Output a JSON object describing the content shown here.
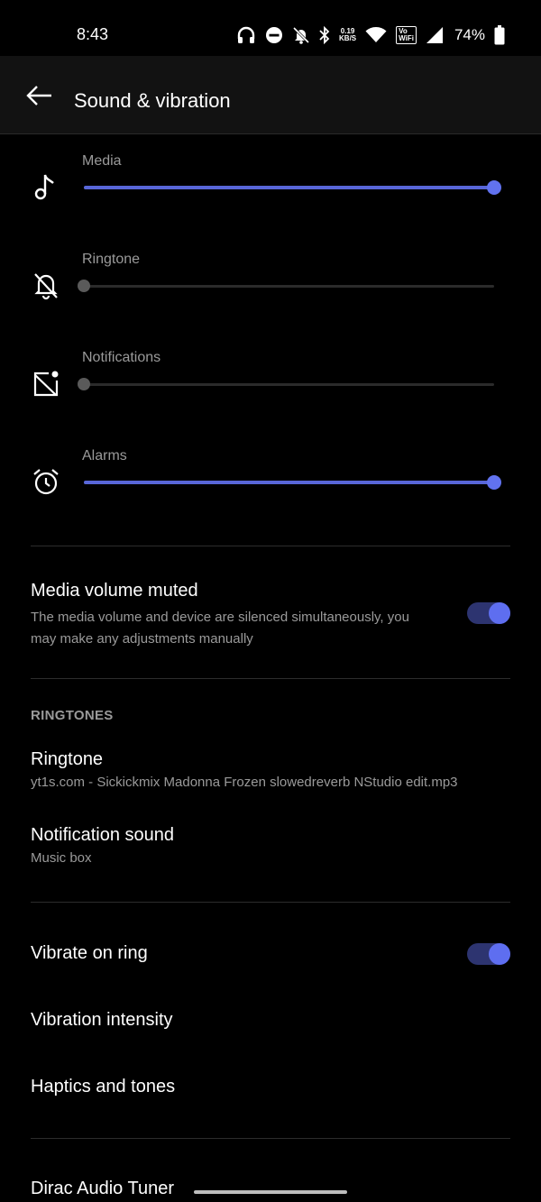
{
  "status_bar": {
    "time": "8:43",
    "net_speed_value": "0.19",
    "net_speed_unit": "KB/S",
    "volte_top": "Vo",
    "volte_bottom": "WiFi",
    "battery": "74%"
  },
  "header": {
    "title": "Sound & vibration"
  },
  "volumes": [
    {
      "label": "Media",
      "icon": "music-note-icon",
      "level": 1.0,
      "active": true
    },
    {
      "label": "Ringtone",
      "icon": "bell-off-icon",
      "level": 0.0,
      "active": false
    },
    {
      "label": "Notifications",
      "icon": "notification-off-icon",
      "level": 0.0,
      "active": false
    },
    {
      "label": "Alarms",
      "icon": "alarm-icon",
      "level": 1.0,
      "active": true
    }
  ],
  "media_muted": {
    "title": "Media volume muted",
    "subtitle_line1": "The media volume and device are silenced simultaneously, you",
    "subtitle_line2": "may make any adjustments manually",
    "enabled": true
  },
  "ringtones_section": {
    "header": "RINGTONES",
    "ringtone_title": "Ringtone",
    "ringtone_value": "yt1s.com - Sickickmix  Madonna Frozen slowedreverb NStudio edit.mp3",
    "notification_title": "Notification sound",
    "notification_value": "Music box"
  },
  "vibration": {
    "vibrate_on_ring": "Vibrate on ring",
    "vibrate_on_ring_enabled": true,
    "intensity": "Vibration intensity",
    "haptics": "Haptics and tones"
  },
  "dirac": {
    "title": "Dirac Audio Tuner"
  },
  "colors": {
    "accent": "#5e6ef0",
    "background": "#000000",
    "header_bg": "#121212"
  }
}
